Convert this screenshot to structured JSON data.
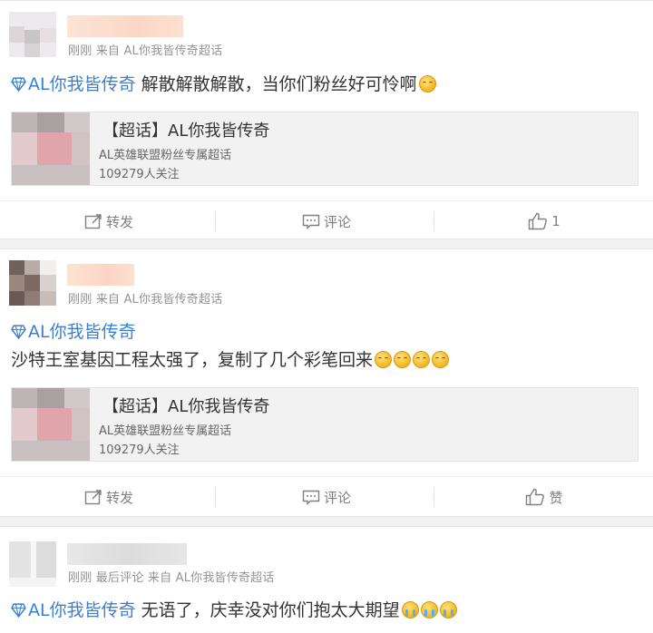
{
  "posts": [
    {
      "meta": "刚刚 来自 AL你我皆传奇超话",
      "topic_link": "AL你我皆传奇",
      "text": " 解散解散解散，当你们粉丝好可怜啊",
      "emojis": [
        "smile"
      ],
      "card": {
        "title": "【超话】AL你我皆传奇",
        "subtitle": "AL英雄联盟粉丝专属超话",
        "followers": "109279人关注"
      },
      "actions": {
        "repost": "转发",
        "comment": "评论",
        "like": "1"
      }
    },
    {
      "meta": "刚刚 来自 AL你我皆传奇超话",
      "topic_link": "AL你我皆传奇",
      "text": "沙特王室基因工程太强了，复制了几个彩笔回来",
      "emojis": [
        "smile",
        "smile",
        "smile",
        "smile"
      ],
      "card": {
        "title": "【超话】AL你我皆传奇",
        "subtitle": "AL英雄联盟粉丝专属超话",
        "followers": "109279人关注"
      },
      "actions": {
        "repost": "转发",
        "comment": "评论",
        "like": "赞"
      }
    },
    {
      "meta": "刚刚 最后评论 来自 AL你我皆传奇超话",
      "topic_link": "AL你我皆传奇",
      "text": " 无语了，庆幸没对你们抱太大期望",
      "emojis": [
        "cry",
        "cry",
        "cry"
      ]
    }
  ],
  "icons": {
    "repost": "repost-icon",
    "comment": "comment-icon",
    "like": "thumbs-up-icon",
    "topic": "diamond-icon"
  },
  "colors": {
    "link": "#3b7fd0",
    "meta": "#939393",
    "action": "#808080"
  }
}
